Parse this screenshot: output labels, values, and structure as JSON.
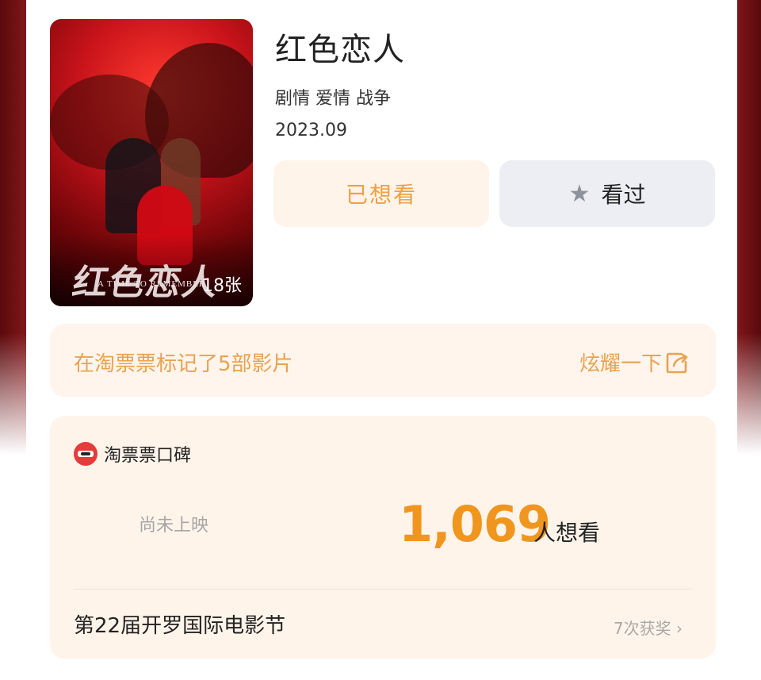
{
  "movie": {
    "title": "红色恋人",
    "genres": "剧情 爱情 战争",
    "date": "2023.09",
    "poster": {
      "calligraphy": "红色恋人",
      "english": "A TIME TO REMEMBER",
      "photo_count": "18张"
    }
  },
  "actions": {
    "want_label": "已想看",
    "seen_label": "看过",
    "seen_icon": "star-icon"
  },
  "mark_bar": {
    "text": "在淘票票标记了5部影片",
    "share_label": "炫耀一下",
    "share_icon": "share-icon"
  },
  "rating": {
    "brand": "淘票票口碑",
    "status": "尚未上映",
    "want_count": "1,069",
    "want_unit": "人想看",
    "festival": "第22届开罗国际电影节",
    "awards": "7次获奖 ›"
  },
  "colors": {
    "accent": "#f0961e",
    "accent_light": "#fff4ea",
    "mark_text": "#e9a24e",
    "logo_red": "#e53b3b"
  }
}
